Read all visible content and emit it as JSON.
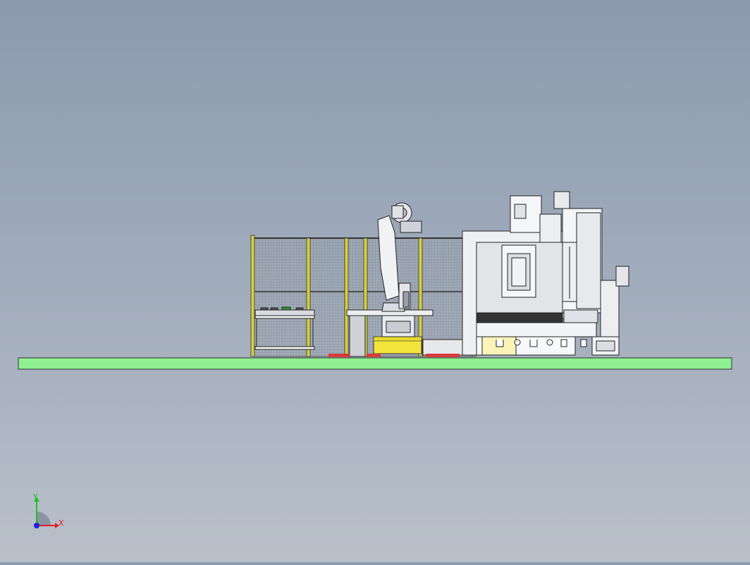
{
  "viewport": {
    "background_top": "#8b9aae",
    "background_bottom": "#b9c0ca",
    "floor_color": "#8ff08f",
    "guard_post_color": "#d6cf3a",
    "safety_yellow": "#f2e43a",
    "floor_marking_red": "#d83a3a"
  },
  "triad": {
    "x_label": "X",
    "y_label": "Y",
    "x_color": "#e02020",
    "y_color": "#20c020",
    "z_color": "#2020e0"
  }
}
